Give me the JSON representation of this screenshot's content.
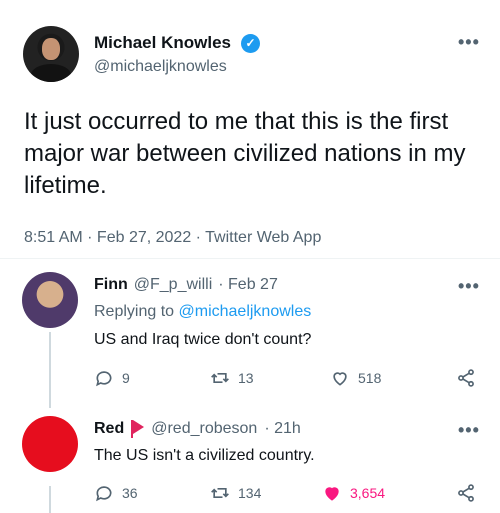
{
  "main_tweet": {
    "display_name": "Michael Knowles",
    "handle": "@michaeljknowles",
    "verified_mark": "✓",
    "more_label": "•••",
    "text": "It just occurred to me that this is the first major war between civilized nations in my lifetime.",
    "timestamp": "8:51 AM · Feb 27, 2022 · Twitter Web App"
  },
  "replies": [
    {
      "display_name": "Finn",
      "handle": "@F_p_willi",
      "time": "· Feb 27",
      "replying_prefix": "Replying to",
      "replying_to": "@michaeljknowles",
      "text": "US and Iraq twice don't count?",
      "more_label": "•••",
      "reply_count": "9",
      "retweet_count": "13",
      "like_count": "518"
    },
    {
      "display_name": "Red",
      "handle": "@red_robeson",
      "time": "· 21h",
      "text": "The US isn't a civilized country.",
      "more_label": "•••",
      "reply_count": "36",
      "retweet_count": "134",
      "like_count": "3,654"
    }
  ],
  "colors": {
    "accent": "#1d9bf0",
    "like": "#f91880",
    "red_avatar": "#e60d1e"
  },
  "icons": [
    "verified-badge-icon",
    "reply-icon",
    "retweet-icon",
    "like-icon",
    "share-icon",
    "flag-icon",
    "more-icon"
  ]
}
